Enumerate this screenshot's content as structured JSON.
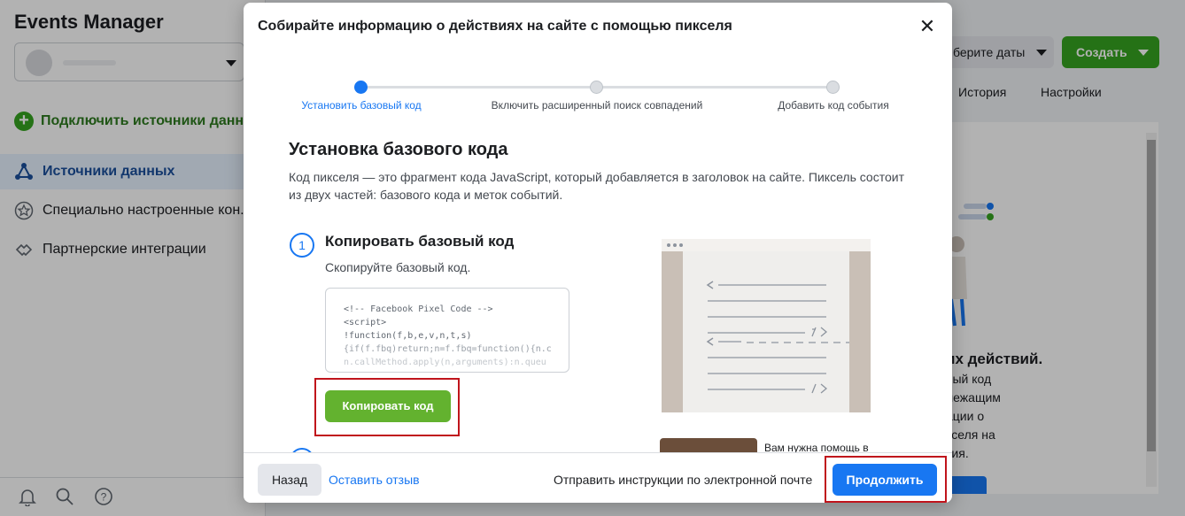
{
  "app": {
    "title": "Events Manager",
    "connect_label": "Подключить источники данных",
    "nav": [
      {
        "label": "Источники данных",
        "icon": "data-sources-icon",
        "active": true
      },
      {
        "label": "Специально настроенные кон...",
        "icon": "star-icon",
        "active": false
      },
      {
        "label": "Партнерские интеграции",
        "icon": "handshake-icon",
        "active": false
      }
    ],
    "date_select": "берите даты",
    "create_label": "Создать",
    "tabs": [
      "История",
      "Настройки"
    ],
    "panel": {
      "heading": "их действий.",
      "lines": [
        "вый код",
        "лежащим",
        "ации о",
        "кселя на",
        "тия."
      ]
    }
  },
  "modal": {
    "title": "Собирайте информацию о действиях на сайте с помощью пикселя",
    "steps": [
      {
        "label": "Установить базовый код",
        "active": true
      },
      {
        "label": "Включить расширенный поиск совпадений",
        "active": false
      },
      {
        "label": "Добавить код события",
        "active": false
      }
    ],
    "section_title": "Установка базового кода",
    "section_desc": "Код пикселя — это фрагмент кода JavaScript, который добавляется в заголовок на сайте. Пиксель состоит из двух частей: базового кода и меток событий.",
    "step1": {
      "number": "1",
      "title": "Копировать базовый код",
      "desc": "Скопируйте базовый код.",
      "code_lines": [
        "<!-- Facebook Pixel Code -->",
        "<script>",
        "!function(f,b,e,v,n,t,s)",
        "{if(f.fbq)return;n=f.fbq=function(){n.c",
        "n.callMethod.apply(n,arguments):n.queu"
      ],
      "copy_button": "Копировать код"
    },
    "help_text": "Вам нужна помощь в",
    "footer": {
      "back": "Назад",
      "feedback": "Оставить отзыв",
      "email": "Отправить инструкции по электронной почте",
      "continue": "Продолжить"
    }
  },
  "colors": {
    "accent_blue": "#1877f2",
    "green_button": "#63b22f",
    "highlight_red": "#c0141c"
  }
}
